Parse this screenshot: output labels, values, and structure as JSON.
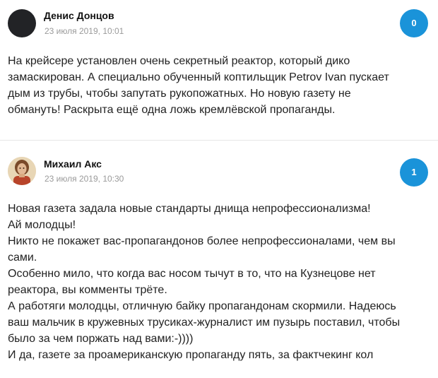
{
  "comments": [
    {
      "author": "Денис Донцов",
      "date": "23 июля 2019, 10:01",
      "rating": "0",
      "lines": [
        "На крейсере установлен очень секретный реактор, который дико",
        "замаскирован. А специально обученный коптильщик Petrov Ivan пускает",
        "дым из трубы, чтобы запутать рукопожатных. Но новую газету не",
        "обмануть! Раскрыта ещё одна ложь кремлёвской пропаганды."
      ]
    },
    {
      "author": "Михаил Акс",
      "date": "23 июля 2019, 10:30",
      "rating": "1",
      "lines": [
        "Новая газета задала новые стандарты днища непрофессионализма!",
        "Ай молодцы!",
        "Никто не покажет вас-пропагандонов более непрофессионалами, чем вы",
        "сами.",
        "Особенно мило, что когда вас носом тычут в то, что на Кузнецове нет",
        "реактора, вы комменты трёте.",
        "А работяги молодцы, отличную байку пропагандонам скормили. Надеюсь",
        "ваш мальчик в кружевных трусиках-журналист им пузырь поставил, чтобы",
        "было за чем поржать над вами:-))))",
        "И да, газете за проамериканскую пропаганду пять, за фактчекинг кол"
      ]
    }
  ],
  "colors": {
    "badge": "#1a93d9",
    "date": "#9a9a9a",
    "divider": "#e6e6e6"
  },
  "icons": {
    "avatar_1": "avatar-dark-icon",
    "avatar_2": "avatar-portrait-icon"
  }
}
